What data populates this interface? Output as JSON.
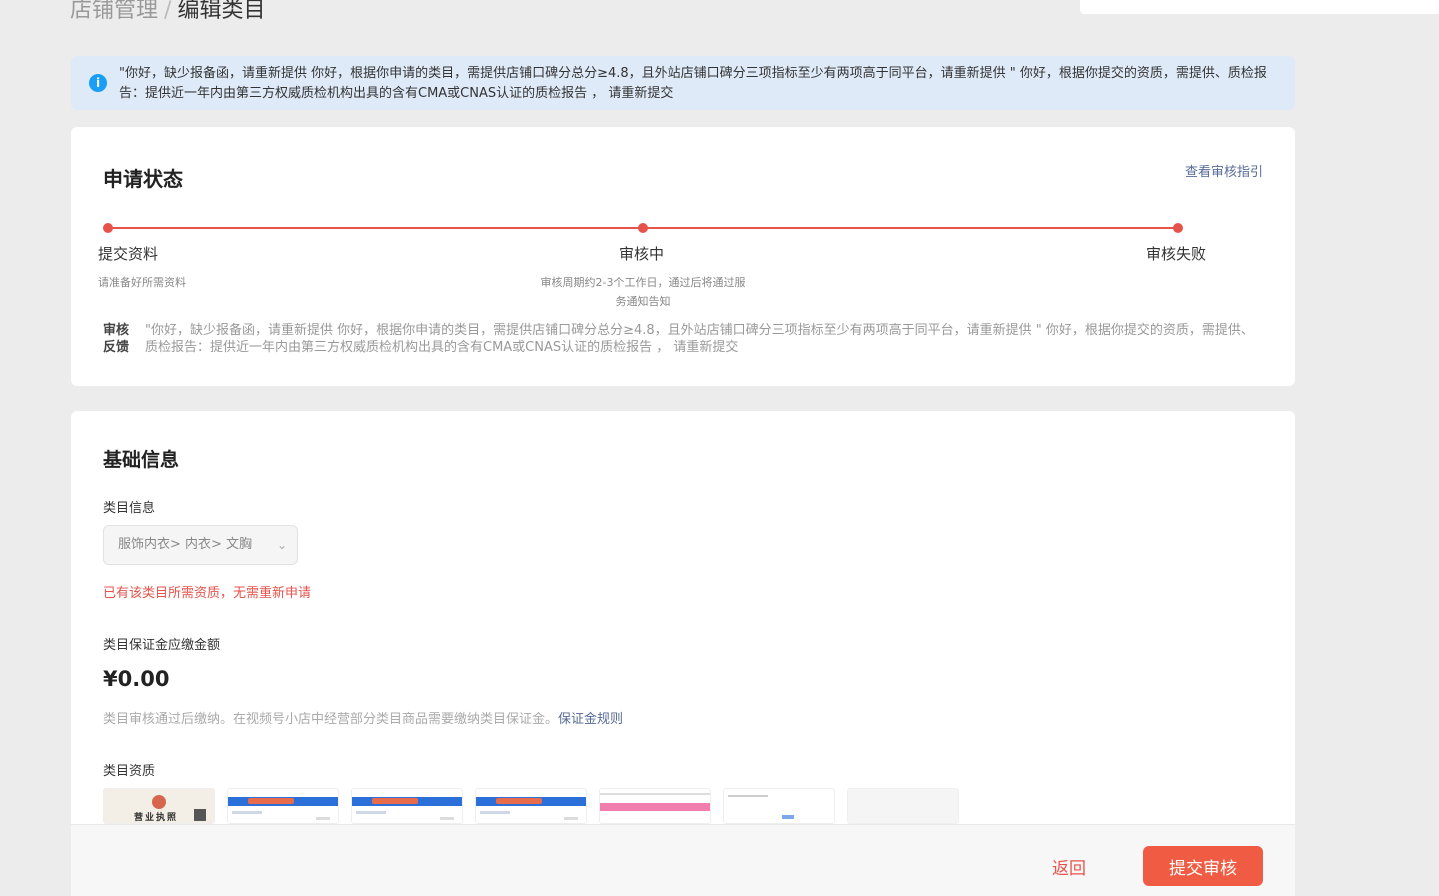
{
  "breadcrumb": {
    "parent": "店铺管理",
    "separator": "/",
    "current": "编辑类目"
  },
  "notice": {
    "text": "\"你好，缺少报备函，请重新提供 你好，根据你申请的类目，需提供店铺口碑分总分≥4.8，且外站店铺口碑分三项指标至少有两项高于同平台，请重新提供 \" 你好，根据你提交的资质，需提供、质检报告：提供近一年内由第三方权威质检机构出具的含有CMA或CNAS认证的质检报告 ， 请重新提交"
  },
  "status": {
    "title": "申请状态",
    "guide_link": "查看审核指引",
    "steps": [
      {
        "label": "提交资料",
        "desc": "请准备好所需资料"
      },
      {
        "label": "审核中",
        "desc": "审核周期约2-3个工作日，通过后将通过服务通知告知"
      },
      {
        "label": "审核失败",
        "desc": ""
      }
    ],
    "feedback_label": "审核反馈",
    "feedback_text": "\"你好，缺少报备函，请重新提供 你好，根据你申请的类目，需提供店铺口碑分总分≥4.8，且外站店铺口碑分三项指标至少有两项高于同平台，请重新提供 \" 你好，根据你提交的资质，需提供、质检报告：提供近一年内由第三方权威质检机构出具的含有CMA或CNAS认证的质检报告 ， 请重新提交",
    "accent_color": "#e5534b"
  },
  "basic": {
    "title": "基础信息",
    "category_label": "类目信息",
    "category_value": "服饰内衣> 内衣> 文胸",
    "error_text": "已有该类目所需资质，无需重新申请",
    "deposit_label": "类目保证金应缴金额",
    "deposit_amount": "¥0.00",
    "deposit_hint": "类目审核通过后缴纳。在视频号小店中经营部分类目商品需要缴纳类目保证金。",
    "deposit_rule_link": "保证金规则",
    "qualification_label": "类目资质",
    "license_text": "营业执照"
  },
  "footer": {
    "back_label": "返回",
    "submit_label": "提交审核",
    "submit_color": "#f05b43"
  }
}
